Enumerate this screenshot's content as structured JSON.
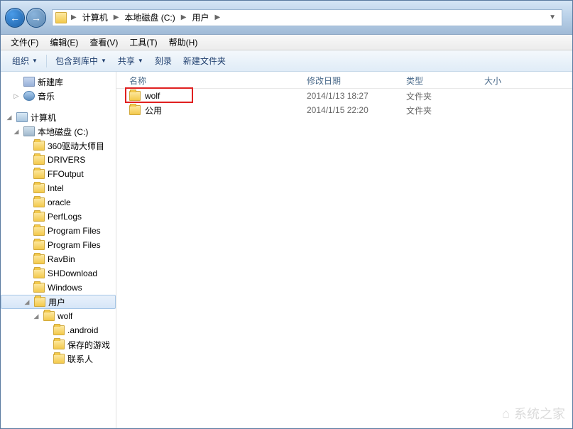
{
  "breadcrumb": [
    "计算机",
    "本地磁盘 (C:)",
    "用户"
  ],
  "menubar": [
    "文件(F)",
    "编辑(E)",
    "查看(V)",
    "工具(T)",
    "帮助(H)"
  ],
  "toolbar": {
    "organize": "组织",
    "include": "包含到库中",
    "share": "共享",
    "burn": "刻录",
    "newfolder": "新建文件夹"
  },
  "tree": {
    "library": "新建库",
    "music": "音乐",
    "computer": "计算机",
    "drive_c": "本地磁盘 (C:)",
    "folders": [
      "360驱动大师目",
      "DRIVERS",
      "FFOutput",
      "Intel",
      "oracle",
      "PerfLogs",
      "Program Files",
      "Program Files",
      "RavBin",
      "SHDownload",
      "Windows"
    ],
    "users": "用户",
    "wolf": "wolf",
    "wolf_sub": [
      ".android",
      "保存的游戏",
      "联系人"
    ]
  },
  "columns": {
    "name": "名称",
    "date": "修改日期",
    "type": "类型",
    "size": "大小"
  },
  "rows": [
    {
      "name": "wolf",
      "date": "2014/1/13 18:27",
      "type": "文件夹",
      "highlight": true
    },
    {
      "name": "公用",
      "date": "2014/1/15 22:20",
      "type": "文件夹",
      "highlight": false
    }
  ],
  "watermark": {
    "brand": "系统之家"
  }
}
